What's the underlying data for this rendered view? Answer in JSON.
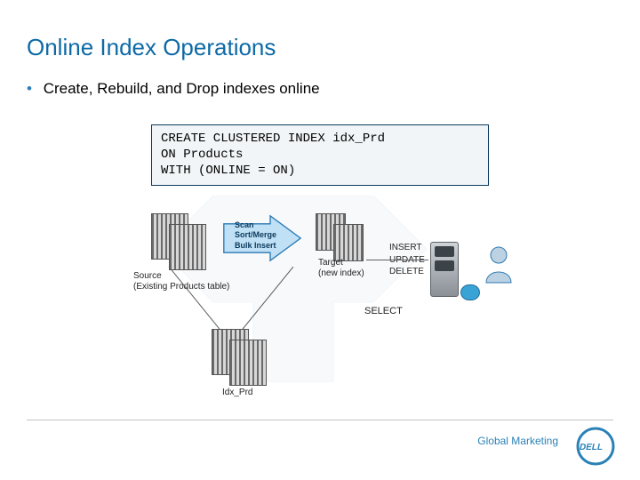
{
  "title": "Online Index Operations",
  "bullet": "Create, Rebuild, and Drop indexes online",
  "code": "CREATE CLUSTERED INDEX idx_Prd\nON Products\nWITH (ONLINE = ON)",
  "diagram": {
    "step_arrow_text": "Scan\nSort/Merge\nBulk Insert",
    "source_caption": "Source\n(Existing Products table)",
    "target_caption": "Target\n(new index)",
    "ops": "INSERT\nUPDATE\nDELETE",
    "select": "SELECT",
    "result_caption": "Idx_Prd"
  },
  "footer": {
    "text": "Global Marketing",
    "brand": "DELL"
  },
  "colors": {
    "title": "#0d6aa6",
    "footer": "#2a81b6",
    "arrow_fill": "#bfe0f5",
    "arrow_stroke": "#2b79b4"
  }
}
